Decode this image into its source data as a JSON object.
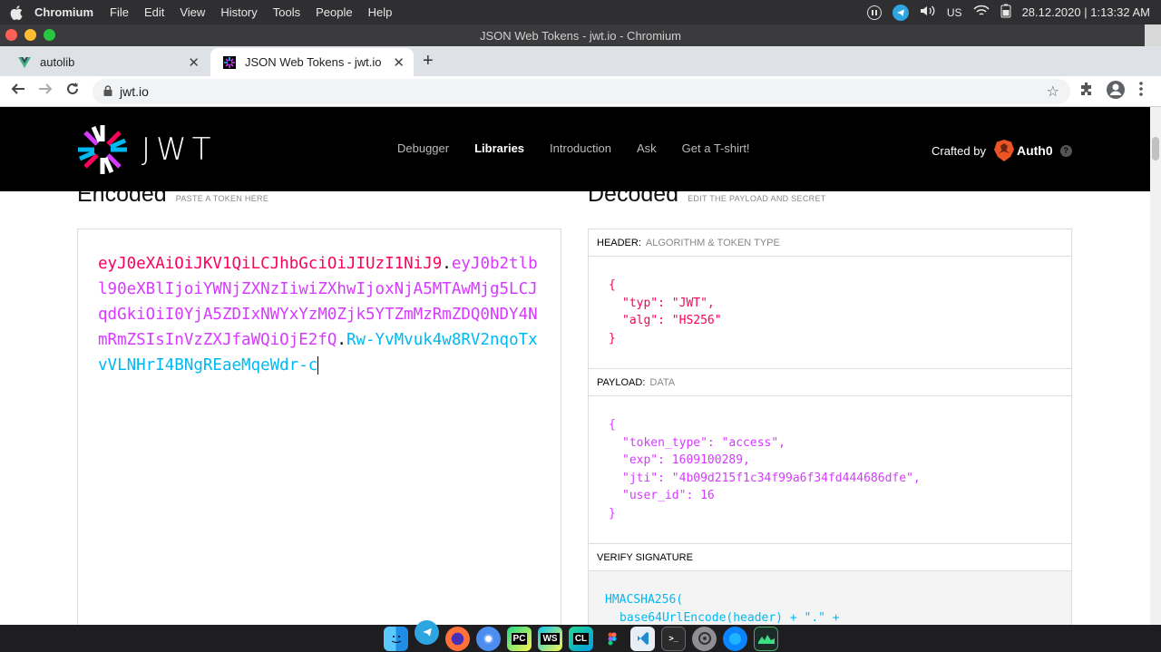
{
  "menubar": {
    "app_name": "Chromium",
    "items": [
      "File",
      "Edit",
      "View",
      "History",
      "Tools",
      "People",
      "Help"
    ],
    "keyboard_layout": "US",
    "datetime": "28.12.2020 | 1:13:32 AM"
  },
  "window": {
    "title": "JSON Web Tokens - jwt.io - Chromium"
  },
  "tabs": [
    {
      "label": "autolib",
      "active": false
    },
    {
      "label": "JSON Web Tokens - jwt.io",
      "active": true
    }
  ],
  "address_bar": {
    "url": "jwt.io"
  },
  "jwt_header": {
    "logo_text": "JWT",
    "nav": [
      "Debugger",
      "Libraries",
      "Introduction",
      "Ask",
      "Get a T-shirt!"
    ],
    "current_nav": "Libraries",
    "crafted_by": "Crafted by",
    "brand": "Auth0"
  },
  "encoded": {
    "title": "Encoded",
    "subtitle": "PASTE A TOKEN HERE",
    "header_part": "eyJ0eXAiOiJKV1QiLCJhbGciOiJIUzI1NiJ9",
    "payload_part": "eyJ0b2tlbl90eXBlIjoiYWNjZXNzIiwiZXhwIjoxNjA5MTAwMjg5LCJqdGkiOiI0YjA5ZDIxNWYxYzM0Zjk5YTZmMzRmZDQ0NDY4NmRmZSIsInVzZXJfaWQiOjE2fQ",
    "signature_part": "Rw-YvMvuk4w8RV2nqoTxvVLNHrI4BNgREaeMqeWdr-c",
    "dot": "."
  },
  "decoded": {
    "title": "Decoded",
    "subtitle": "EDIT THE PAYLOAD AND SECRET",
    "header_label": "HEADER:",
    "header_sub": "ALGORITHM & TOKEN TYPE",
    "header_lines": [
      "{",
      "\"typ\": \"JWT\",",
      "\"alg\": \"HS256\"",
      "}"
    ],
    "payload_label": "PAYLOAD:",
    "payload_sub": "DATA",
    "payload_lines": [
      "{",
      "\"token_type\": \"access\",",
      "\"exp\": 1609100289,",
      "\"jti\": \"4b09d215f1c34f99a6f34fd444686dfe\",",
      "\"user_id\": 16",
      "}"
    ],
    "signature_label": "VERIFY SIGNATURE",
    "signature_lines": [
      "HMACSHA256(",
      "base64UrlEncode(header) + \".\" +"
    ]
  },
  "dock": {
    "icons": [
      "finder-icon",
      "telegram-icon",
      "firefox-icon",
      "chromium-icon",
      "pycharm-icon",
      "webstorm-icon",
      "clion-icon",
      "figma-icon",
      "vscode-icon",
      "terminal-icon",
      "settings-icon",
      "browser-icon",
      "monitor-icon"
    ],
    "labels": {
      "pycharm": "PC",
      "webstorm": "WS",
      "clion": "CL"
    }
  },
  "colors": {
    "header_red": "#fb015b",
    "payload_purple": "#d63aff",
    "signature_cyan": "#00b9f1"
  }
}
